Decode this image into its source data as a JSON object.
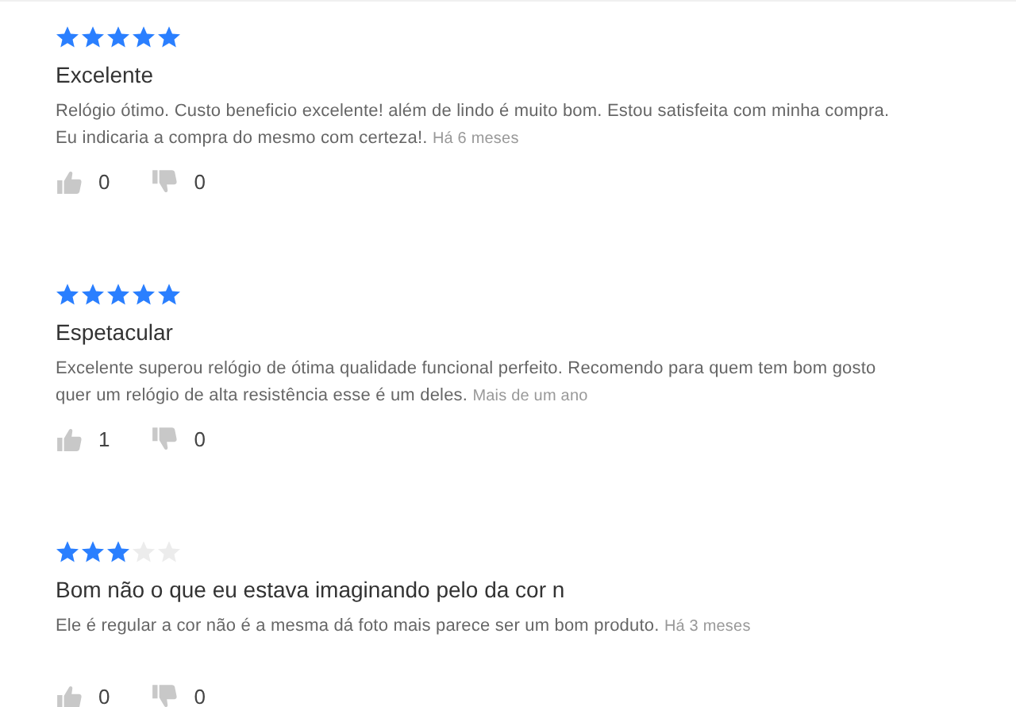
{
  "reviews": [
    {
      "stars": 5,
      "title": "Excelente",
      "body": "Relógio ótimo. Custo beneficio excelente! além de lindo é muito bom. Estou satisfeita com minha compra. Eu indicaria a compra do mesmo com certeza!.",
      "time": "Há 6 meses",
      "likes": "0",
      "dislikes": "0"
    },
    {
      "stars": 5,
      "title": "Espetacular",
      "body": "Excelente superou relógio de ótima qualidade funcional perfeito. Recomendo para quem tem bom gosto quer um relógio de alta resistência esse é um deles.",
      "time": "Mais de um ano",
      "likes": "1",
      "dislikes": "0"
    },
    {
      "stars": 3,
      "title": "Bom não o que eu estava imaginando pelo da cor n",
      "body": "Ele é regular a cor não é a mesma dá foto mais parece ser um bom produto.",
      "time": "Há 3 meses",
      "likes": "0",
      "dislikes": "0"
    }
  ]
}
